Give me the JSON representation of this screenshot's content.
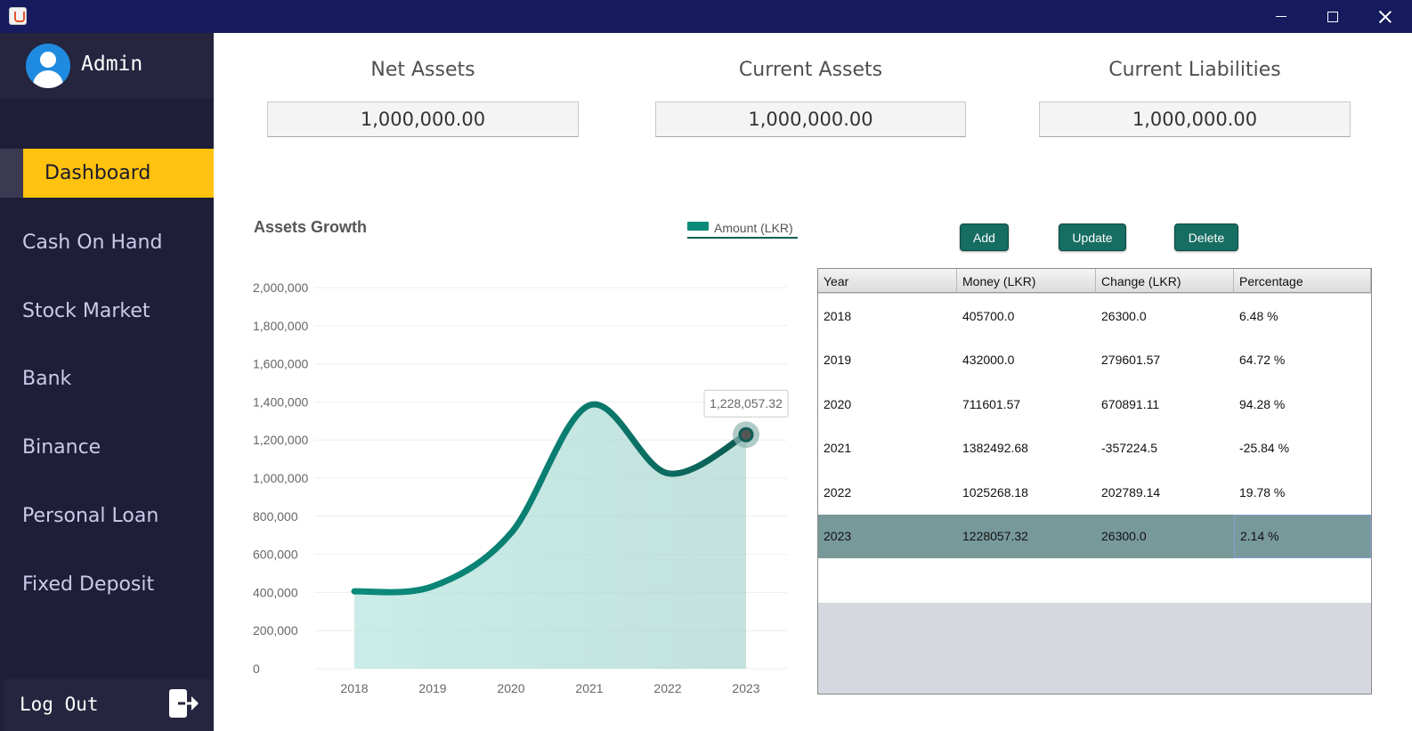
{
  "window": {
    "app_icon": "java-cup-icon"
  },
  "sidebar": {
    "user_name": "Admin",
    "items": [
      {
        "label": "Dashboard",
        "active": true
      },
      {
        "label": "Cash On Hand",
        "active": false
      },
      {
        "label": "Stock Market",
        "active": false
      },
      {
        "label": "Bank",
        "active": false
      },
      {
        "label": "Binance",
        "active": false
      },
      {
        "label": "Personal Loan",
        "active": false
      },
      {
        "label": "Fixed Deposit",
        "active": false
      }
    ],
    "logout_label": "Log Out"
  },
  "stats": [
    {
      "title": "Net Assets",
      "value": "1,000,000.00"
    },
    {
      "title": "Current Assets",
      "value": "1,000,000.00"
    },
    {
      "title": "Current Liabilities",
      "value": "1,000,000.00"
    }
  ],
  "actions": {
    "add": "Add",
    "update": "Update",
    "delete": "Delete"
  },
  "table": {
    "columns": [
      "Year",
      "Money (LKR)",
      "Change (LKR)",
      "Percentage"
    ],
    "rows": [
      [
        "2018",
        "405700.0",
        "26300.0",
        "6.48 %"
      ],
      [
        "2019",
        "432000.0",
        "279601.57",
        "64.72 %"
      ],
      [
        "2020",
        "711601.57",
        "670891.11",
        "94.28 %"
      ],
      [
        "2021",
        "1382492.68",
        "-357224.5",
        "-25.84 %"
      ],
      [
        "2022",
        "1025268.18",
        "202789.14",
        "19.78 %"
      ],
      [
        "2023",
        "1228057.32",
        "26300.0",
        "2.14 %"
      ]
    ],
    "selected_row": 5
  },
  "colors": {
    "accent": "#ffc20e",
    "sidebar": "#1e1e38",
    "teal": "#0b8a7a",
    "teal_dark": "#0d5c54",
    "button": "#166d62",
    "selected_row": "#78999a"
  },
  "chart_data": {
    "type": "area",
    "title": "Assets Growth",
    "legend": "Amount (LKR)",
    "legend_position": "top-right",
    "categories": [
      "2018",
      "2019",
      "2020",
      "2021",
      "2022",
      "2023"
    ],
    "series": [
      {
        "name": "Amount (LKR)",
        "values": [
          405700.0,
          432000.0,
          711601.57,
          1382492.68,
          1025268.18,
          1228057.32
        ]
      }
    ],
    "yticks": [
      "0",
      "200,000",
      "400,000",
      "600,000",
      "800,000",
      "1,000,000",
      "1,200,000",
      "1,400,000",
      "1,600,000",
      "1,800,000",
      "2,000,000"
    ],
    "ylim": [
      0,
      2000000
    ],
    "grid": true,
    "tooltip": {
      "index": 5,
      "text": "1,228,057.32"
    }
  }
}
